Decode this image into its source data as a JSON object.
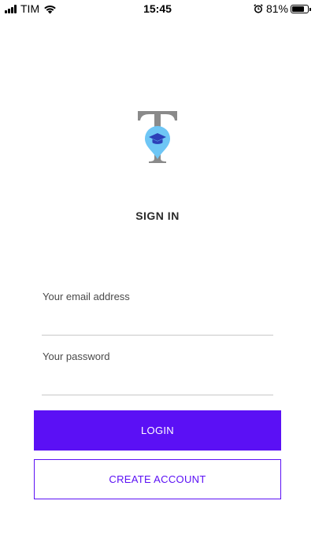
{
  "status_bar": {
    "carrier": "TIM",
    "time": "15:45",
    "battery_percent": "81%",
    "battery_level": 0.81,
    "icons": [
      "signal-icon",
      "wifi-icon",
      "alarm-icon",
      "battery-icon"
    ]
  },
  "logo": {
    "icon": "graduation-cap-pin-logo",
    "colors": {
      "letter": "#8a8a8a",
      "pin": "#6ec6f5",
      "cap": "#2c3fb8"
    }
  },
  "page": {
    "title": "SIGN IN"
  },
  "form": {
    "email": {
      "label": "Your email address",
      "value": ""
    },
    "password": {
      "label": "Your password",
      "value": ""
    }
  },
  "actions": {
    "login_label": "LOGIN",
    "create_account_label": "CREATE ACCOUNT"
  },
  "colors": {
    "accent": "#5b10f5",
    "background": "#ffffff",
    "divider": "#c8c8c8"
  }
}
